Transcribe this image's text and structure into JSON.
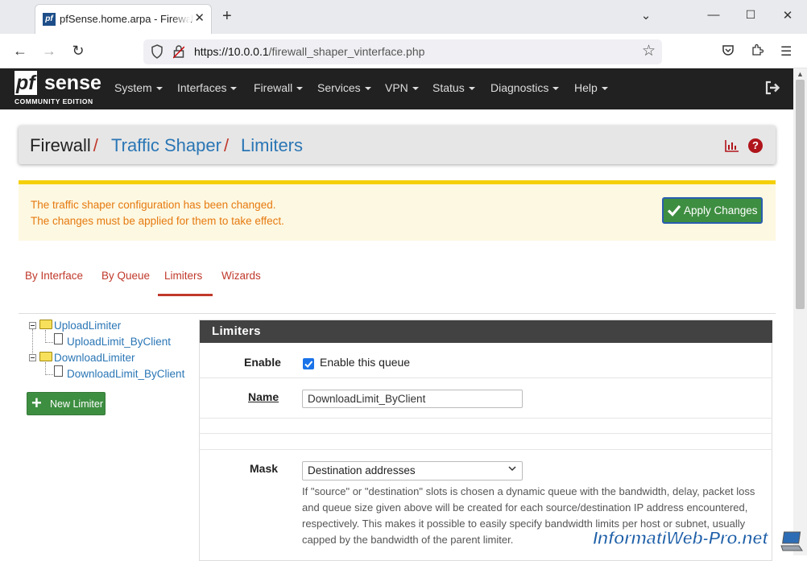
{
  "browser": {
    "tab_title": "pfSense.home.arpa - Firewall: Traffic Shaper: Limiters",
    "favicon_text": "pf",
    "url_host": "https://10.0.0.1",
    "url_path": "/firewall_shaper_vinterface.php"
  },
  "pfsense": {
    "logo_pf": "pf",
    "logo_sense": "sense",
    "logo_edition": "COMMUNITY EDITION",
    "menu": [
      "System",
      "Interfaces",
      "Firewall",
      "Services",
      "VPN",
      "Status",
      "Diagnostics",
      "Help"
    ]
  },
  "breadcrumb": {
    "items": [
      "Firewall",
      "Traffic Shaper",
      "Limiters"
    ],
    "separator": "/"
  },
  "alert": {
    "line1": "The traffic shaper configuration has been changed.",
    "line2": "The changes must be applied for them to take effect.",
    "apply_label": "Apply Changes"
  },
  "tabs": {
    "items": [
      "By Interface",
      "By Queue",
      "Limiters",
      "Wizards"
    ],
    "active": "Limiters"
  },
  "tree": {
    "items": [
      {
        "label": "UploadLimiter",
        "children": [
          "UploadLimit_ByClient"
        ]
      },
      {
        "label": "DownloadLimiter",
        "children": [
          "DownloadLimit_ByClient"
        ]
      }
    ],
    "new_label": "New Limiter"
  },
  "panel": {
    "title": "Limiters",
    "enable_label": "Enable",
    "enable_checkbox_label": "Enable this queue",
    "enable_checked": true,
    "name_label": "Name",
    "name_value": "DownloadLimit_ByClient",
    "mask_label": "Mask",
    "mask_value": "Destination addresses",
    "mask_help": "If \"source\" or \"destination\" slots is chosen a dynamic queue with the bandwidth, delay, packet loss and queue size given above will be created for each source/destination IP address encountered, respectively. This makes it possible to easily specify bandwidth limits per host or subnet, usually capped by the bandwidth of the parent limiter."
  },
  "watermark": "InformatiWeb-Pro.net",
  "colors": {
    "navbar": "#212121",
    "link": "#2a76b5",
    "accent_red": "#c0392b",
    "alert_text": "#e67a10",
    "alert_border": "#f4d00b",
    "button_green": "#3e8e41"
  }
}
